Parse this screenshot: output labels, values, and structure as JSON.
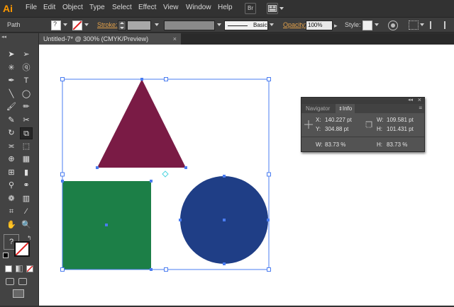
{
  "app": {
    "logo": "Ai"
  },
  "menu": {
    "items": [
      "File",
      "Edit",
      "Object",
      "Type",
      "Select",
      "Effect",
      "View",
      "Window",
      "Help"
    ],
    "bridge_button": "Br"
  },
  "control_bar": {
    "selection_type": "Path",
    "stroke_label": "Stroke:",
    "brush_style": "Basic",
    "opacity_label": "Opacity:",
    "opacity_value": "100%",
    "style_label": "Style:"
  },
  "document_tab": {
    "title": "Untitled-7* @ 300% (CMYK/Preview)"
  },
  "tools": {
    "icons": [
      "selection-tool",
      "direct-selection-tool",
      "magic-wand-tool",
      "lasso-tool",
      "pen-tool",
      "type-tool",
      "line-segment-tool",
      "ellipse-tool",
      "paintbrush-tool",
      "pencil-tool",
      "blob-brush-tool",
      "eraser-tool",
      "rotate-tool",
      "scale-tool",
      "width-tool",
      "free-transform-tool",
      "shape-builder-tool",
      "perspective-grid-tool",
      "mesh-tool",
      "gradient-tool",
      "eyedropper-tool",
      "blend-tool",
      "symbol-sprayer-tool",
      "column-graph-tool",
      "artboard-tool",
      "slice-tool",
      "hand-tool",
      "zoom-tool"
    ],
    "help_glyph": "?"
  },
  "info_panel": {
    "tabs": [
      "Navigator",
      "Info"
    ],
    "active_tab": "Info",
    "x_label": "X:",
    "x_value": "140.227 pt",
    "y_label": "Y:",
    "y_value": "304.88 pt",
    "w_label": "W:",
    "w_value": "109.581 pt",
    "h_label": "H:",
    "h_value": "101.431 pt",
    "w_percent_label": "W:",
    "w_percent_value": "83.73 %",
    "h_percent_label": "H:",
    "h_percent_value": "83.73 %"
  },
  "artwork": {
    "triangle_color": "#7a1b45",
    "square_color": "#1c7f47",
    "circle_color": "#1f3e86",
    "selection_color": "#4a7cf0"
  },
  "colors": {
    "ui_dark": "#323232",
    "accent_orange": "#ff9a00",
    "panel_gray": "#535353"
  }
}
